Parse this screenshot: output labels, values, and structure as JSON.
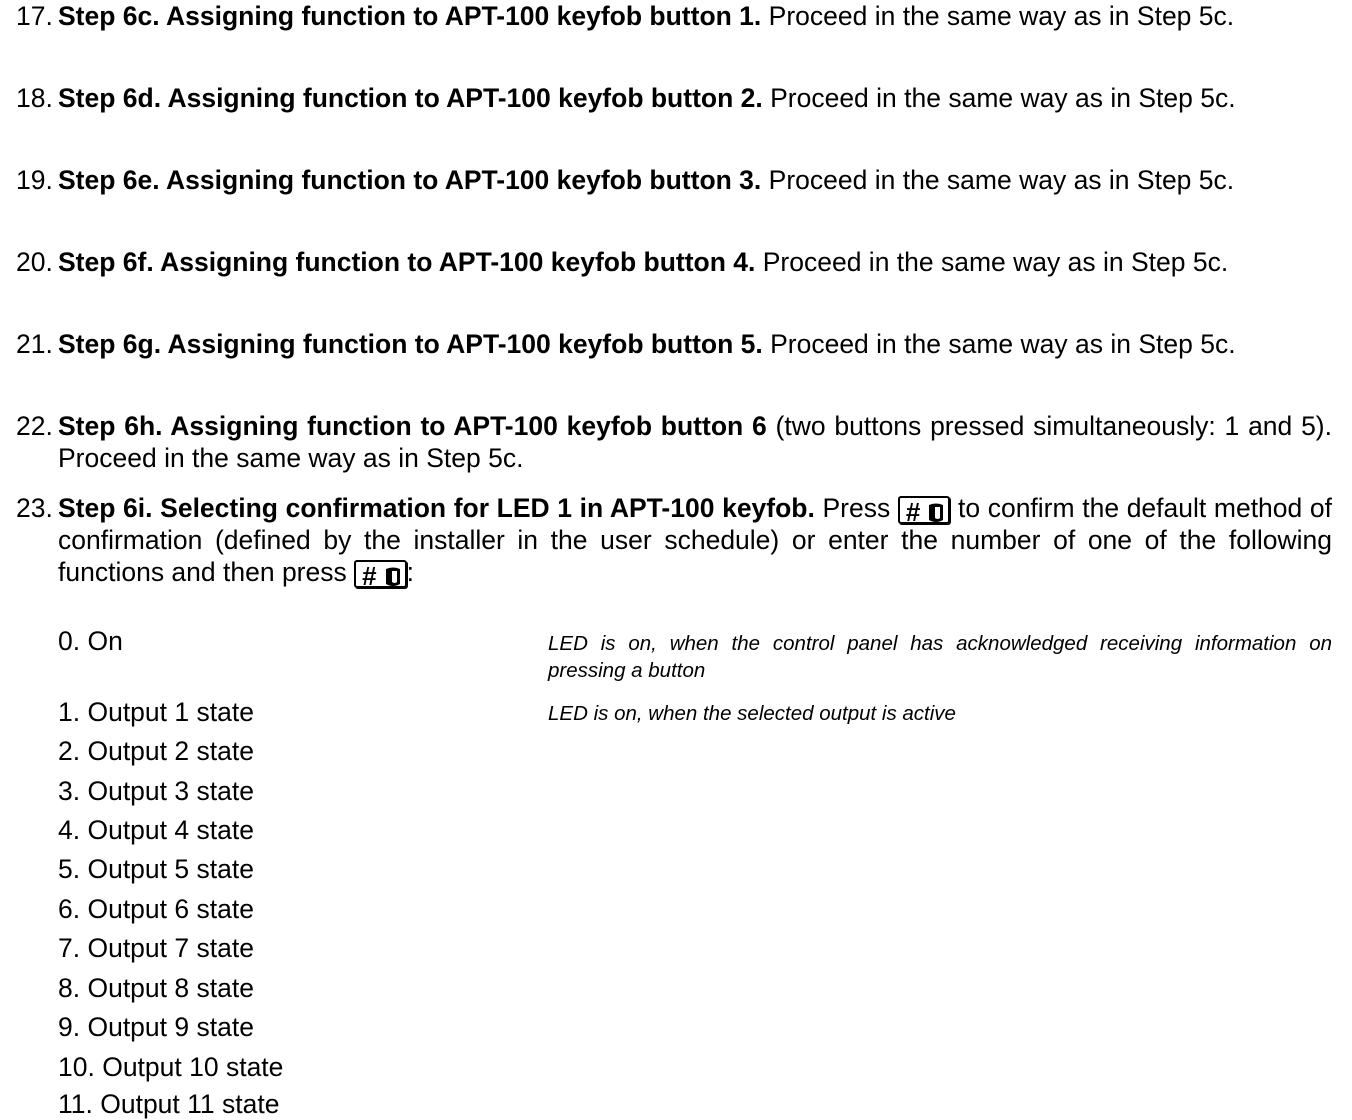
{
  "steps": [
    {
      "number": "17.",
      "bold": "Step 6c. Assigning function to APT-100 keyfob button 1.",
      "text": " Proceed in the same way as in Step 5c."
    },
    {
      "number": "18.",
      "bold": "Step 6d. Assigning function to APT-100 keyfob button 2.",
      "text": " Proceed in the same way as in Step 5c."
    },
    {
      "number": "19.",
      "bold": "Step 6e. Assigning function to APT-100 keyfob button 3.",
      "text": " Proceed in the same way as in Step 5c."
    },
    {
      "number": "20.",
      "bold": "Step 6f. Assigning function to APT-100 keyfob button 4.",
      "text": " Proceed in the same way as in Step 5c."
    },
    {
      "number": "21.",
      "bold": "Step 6g. Assigning function to APT-100 keyfob button 5.",
      "text": " Proceed in the same way as in Step 5c."
    },
    {
      "number": "22.",
      "bold": "Step 6h. Assigning function to APT-100 keyfob button 6",
      "text": " (two buttons pressed simultaneously: 1 and 5). Proceed in the same way as in Step 5c."
    }
  ],
  "step23": {
    "number": "23.",
    "bold": "Step 6i. Selecting confirmation for LED 1 in APT-100 keyfob.",
    "text1": " Press ",
    "text2": " to confirm the default method of confirmation (defined by the installer in the user schedule) or enter the number of one of the following functions and then press ",
    "text3": ":",
    "key_label": "#"
  },
  "options": [
    {
      "label": "0. On",
      "desc": "LED is on, when the control panel has acknowledged receiving information on pressing a button"
    },
    {
      "label": "1. Output 1 state",
      "desc": "LED is on, when the selected output is active"
    },
    {
      "label": "2. Output 2 state",
      "desc": ""
    },
    {
      "label": "3. Output 3 state",
      "desc": ""
    },
    {
      "label": "4. Output 4 state",
      "desc": ""
    },
    {
      "label": "5. Output 5 state",
      "desc": ""
    },
    {
      "label": "6. Output 6 state",
      "desc": ""
    },
    {
      "label": "7. Output 7 state",
      "desc": ""
    },
    {
      "label": "8. Output 8 state",
      "desc": ""
    },
    {
      "label": "9. Output 9 state",
      "desc": ""
    },
    {
      "label": "10. Output 10 state",
      "desc": ""
    },
    {
      "label": "11. Output 11 state",
      "desc": ""
    }
  ],
  "icons": {
    "key_shield": "shield-icon"
  }
}
